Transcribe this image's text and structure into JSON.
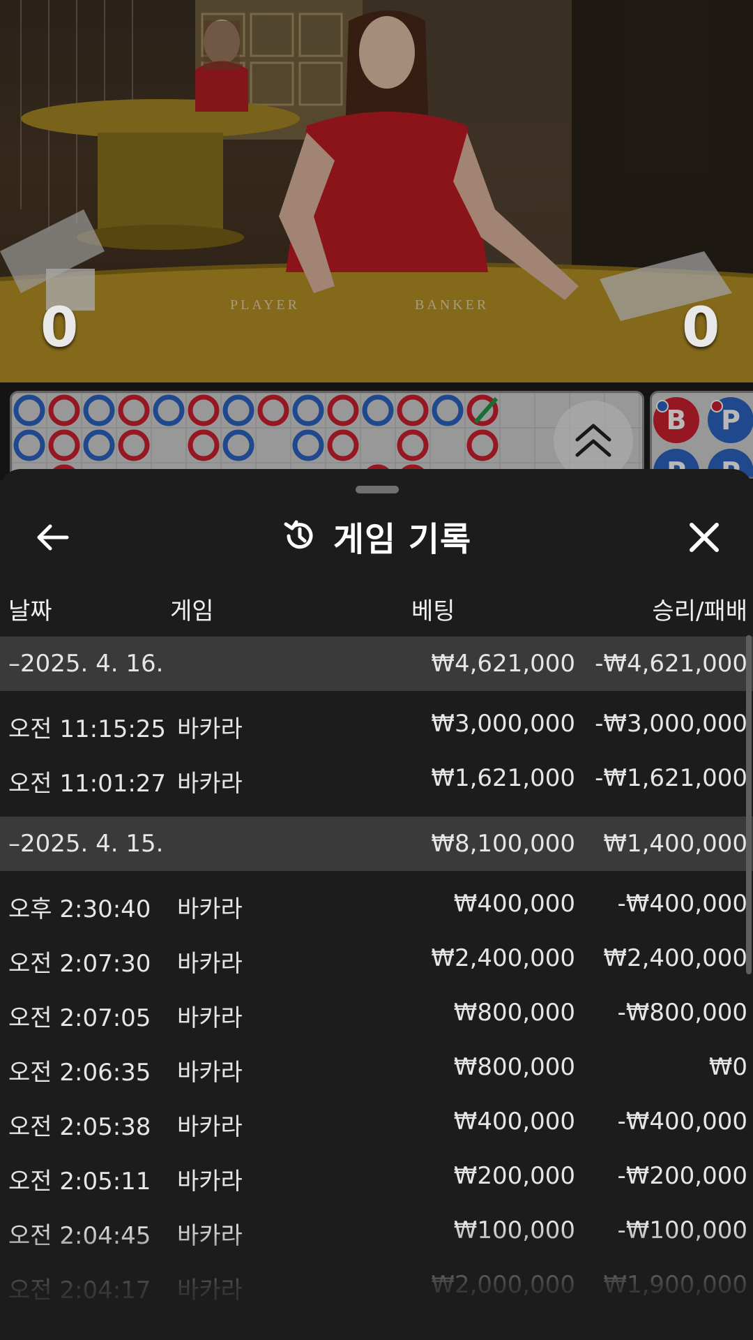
{
  "video": {
    "player_score": "0",
    "banker_score": "0",
    "table_labels": {
      "player": "PLAYER",
      "banker": "BANKER"
    }
  },
  "roadmap": {
    "scroll_icon": "double-chevron-up-icon",
    "mini_road": [
      "B",
      "P",
      "P",
      "P"
    ]
  },
  "sheet": {
    "title": "게임 기록",
    "title_icon": "history-icon",
    "back_icon": "arrow-left-icon",
    "close_icon": "close-icon",
    "columns": {
      "date": "날짜",
      "game": "게임",
      "bet": "베팅",
      "win_loss": "승리/패배"
    },
    "groups": [
      {
        "date": "–2025. 4. 16.",
        "total_bet": "₩4,621,000",
        "total_result": "-₩4,621,000",
        "rows": [
          {
            "time": "오전 11:15:25",
            "game": "바카라",
            "bet": "₩3,000,000",
            "result": "-₩3,000,000"
          },
          {
            "time": "오전 11:01:27",
            "game": "바카라",
            "bet": "₩1,621,000",
            "result": "-₩1,621,000"
          }
        ]
      },
      {
        "date": "–2025. 4. 15.",
        "total_bet": "₩8,100,000",
        "total_result": "₩1,400,000",
        "rows": [
          {
            "time": "오후 2:30:40",
            "game": "바카라",
            "bet": "₩400,000",
            "result": "-₩400,000"
          },
          {
            "time": "오전 2:07:30",
            "game": "바카라",
            "bet": "₩2,400,000",
            "result": "₩2,400,000"
          },
          {
            "time": "오전 2:07:05",
            "game": "바카라",
            "bet": "₩800,000",
            "result": "-₩800,000"
          },
          {
            "time": "오전 2:06:35",
            "game": "바카라",
            "bet": "₩800,000",
            "result": "₩0"
          },
          {
            "time": "오전 2:05:38",
            "game": "바카라",
            "bet": "₩400,000",
            "result": "-₩400,000"
          },
          {
            "time": "오전 2:05:11",
            "game": "바카라",
            "bet": "₩200,000",
            "result": "-₩200,000"
          },
          {
            "time": "오전 2:04:45",
            "game": "바카라",
            "bet": "₩100,000",
            "result": "-₩100,000"
          },
          {
            "time": "오전 2:04:17",
            "game": "바카라",
            "bet": "₩2,000,000",
            "result": "₩1,900,000"
          }
        ]
      }
    ]
  },
  "colors": {
    "banker_red": "#cf2030",
    "player_blue": "#2c64c4",
    "sheet_bg": "#1c1c1c",
    "group_bg": "#3a3a3a"
  }
}
